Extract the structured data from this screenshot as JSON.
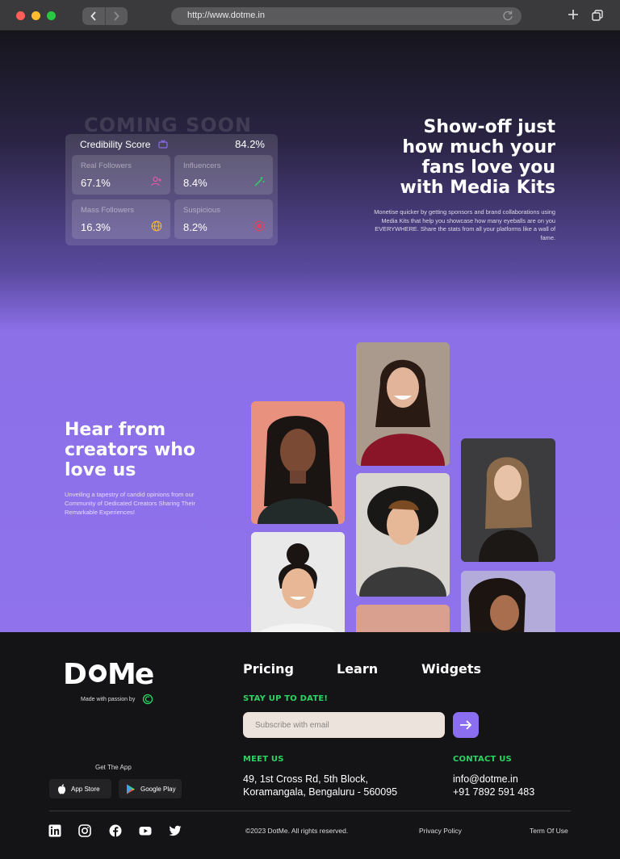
{
  "browser": {
    "url": "http://www.dotme.in"
  },
  "hero": {
    "coming_soon": "COMING SOON",
    "credibility": {
      "title": "Credibility Score",
      "score": "84.2%",
      "stats": [
        {
          "label": "Real Followers",
          "value": "67.1%",
          "icon": "user-plus-icon"
        },
        {
          "label": "Influencers",
          "value": "8.4%",
          "icon": "magic-wand-icon"
        },
        {
          "label": "Mass Followers",
          "value": "16.3%",
          "icon": "globe-icon"
        },
        {
          "label": "Suspicious",
          "value": "8.2%",
          "icon": "stop-icon"
        }
      ]
    },
    "title": "Show-off just\nhow much your\nfans love you\nwith Media Kits",
    "description": "Monetise quicker by getting sponsors and brand collaborations using Media Kits that help you showcase how many eyeballs are on you EVERYWHERE. Share the stats from all your platforms like a wall of fame."
  },
  "testimonials": {
    "title": "Hear from\ncreators who\nlove us",
    "description": "Unveiling a tapestry of candid opinions from our Community of Dedicated Creators Sharing Their Remarkable Experiences!"
  },
  "footer": {
    "logo": "DotMe",
    "made_with": "Made with passion by",
    "get_app": "Get The App",
    "app_store": "App Store",
    "google_play": "Google Play",
    "nav": [
      "Pricing",
      "Learn",
      "Widgets"
    ],
    "stay_up": "STAY UP TO DATE!",
    "subscribe_placeholder": "Subscribe with email",
    "meet_us": "MEET US",
    "address_line1": "49, 1st Cross Rd, 5th Block,",
    "address_line2": "Koramangala, Bengaluru - 560095",
    "contact_us": "CONTACT US",
    "email": "info@dotme.in",
    "phone": "+91 7892 591 483",
    "copyright": "©2023 DotMe. All rights reserved.",
    "privacy": "Privacy Policy",
    "terms": "Term Of Use",
    "social": [
      "linkedin-icon",
      "instagram-icon",
      "facebook-icon",
      "youtube-icon",
      "twitter-icon"
    ]
  },
  "colors": {
    "accent": "#8b6df0",
    "green": "#2bd563",
    "footer_bg": "#141416"
  }
}
